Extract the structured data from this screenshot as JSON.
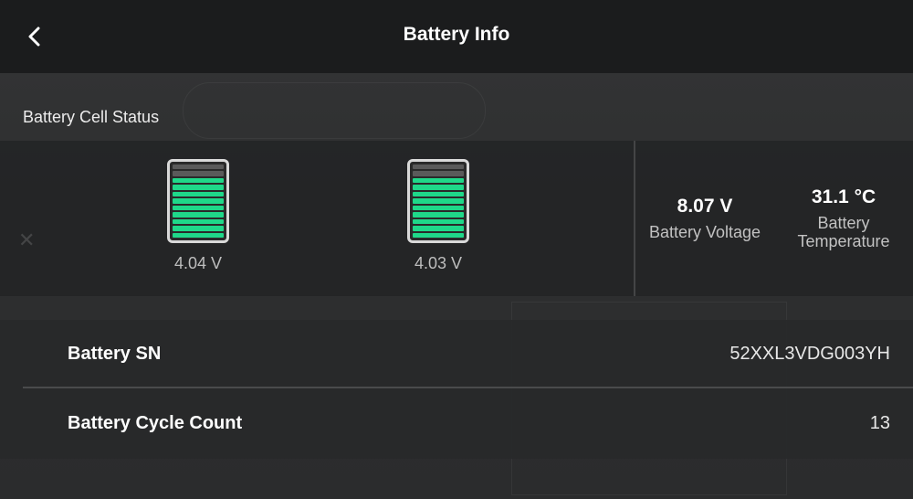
{
  "header": {
    "title": "Battery Info"
  },
  "cell_status": {
    "section_label": "Battery Cell Status",
    "cells": [
      {
        "voltage": "4.04 V",
        "segments_total": 11,
        "segments_filled": 9
      },
      {
        "voltage": "4.03 V",
        "segments_total": 11,
        "segments_filled": 9
      }
    ],
    "battery_voltage": {
      "value": "8.07 V",
      "label": "Battery Voltage"
    },
    "battery_temperature": {
      "value": "31.1 °C",
      "label_line1": "Battery",
      "label_line2": "Temperature"
    }
  },
  "info": {
    "serial": {
      "label": "Battery SN",
      "value": "52XXL3VDG003YH"
    },
    "cycle_count": {
      "label": "Battery Cycle Count",
      "value": "13"
    }
  },
  "colors": {
    "header_bg": "#1b1c1d",
    "cell_fill": "#1fd889",
    "cell_empty": "#5a5a5a"
  },
  "icons": {
    "back": "chevron-left-icon",
    "cell": "battery-cell-icon"
  }
}
